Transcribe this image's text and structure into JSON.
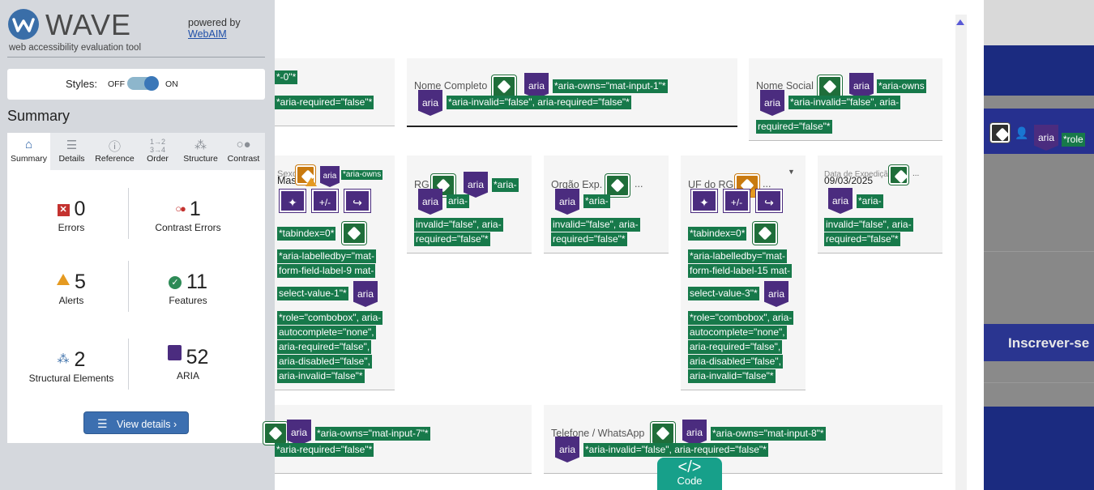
{
  "wave": {
    "title": "WAVE",
    "subtitle": "web accessibility evaluation tool",
    "powered_by": "powered by",
    "webaim_link": "WebAIM",
    "styles_label": "Styles:",
    "off_label": "OFF",
    "on_label": "ON",
    "summary_heading": "Summary",
    "tabs": [
      {
        "label": "Summary",
        "icon": "home-icon",
        "active": true
      },
      {
        "label": "Details",
        "icon": "list-icon"
      },
      {
        "label": "Reference",
        "icon": "info-icon"
      },
      {
        "label": "Order",
        "icon": "order-icon"
      },
      {
        "label": "Structure",
        "icon": "structure-icon"
      },
      {
        "label": "Contrast",
        "icon": "contrast-icon"
      }
    ],
    "stats": {
      "errors": {
        "count": "0",
        "label": "Errors"
      },
      "contrast_errors": {
        "count": "1",
        "label": "Contrast Errors"
      },
      "alerts": {
        "count": "5",
        "label": "Alerts"
      },
      "features": {
        "count": "11",
        "label": "Features"
      },
      "structural": {
        "count": "2",
        "label": "Structural Elements"
      },
      "aria": {
        "count": "52",
        "label": "ARIA"
      }
    },
    "view_details": "View details ›",
    "colors": {
      "accent": "#3c6fb0",
      "error": "#c4322f",
      "alert": "#e59a21",
      "feature": "#2e8b57",
      "aria": "#4b2c7f"
    }
  },
  "page": {
    "fields": {
      "partial_top": {
        "text1": "*-0\"*",
        "text2": "*aria-required=\"false\"*"
      },
      "nome_completo": {
        "label": "Nome Completo",
        "aria": "aria",
        "text1": "*aria-owns=\"mat-input-1\"*",
        "text2": "*aria-invalid=\"false\", aria-required=\"false\"*"
      },
      "nome_social": {
        "label": "Nome Social",
        "aria": "aria",
        "text1": "*aria-owns",
        "text2": "*aria-invalid=\"false\", aria-",
        "text3": "required=\"false\"*"
      },
      "sexo": {
        "label": "Sexo",
        "label_overlay": "Mas",
        "aria": "aria",
        "text_owns": "*aria-owns",
        "tabindex": "*tabindex=0*",
        "labelledby1": "*aria-labelledby=\"mat-",
        "labelledby2": "form-field-label-9 mat-",
        "labelledby3": "select-value-1\"*",
        "role1": "*role=\"combobox\", aria-",
        "role2": "autocomplete=\"none\",",
        "role3": "aria-required=\"false\",",
        "role4": "aria-disabled=\"false\",",
        "role5": "aria-invalid=\"false\"*",
        "btn_labels": [
          "✦",
          "+/-",
          "↪"
        ]
      },
      "rg": {
        "label": "RG",
        "aria": "aria",
        "text1": "*aria-",
        "text2": "aria-",
        "text3": "invalid=\"false\", aria-",
        "text4": "required=\"false\"*"
      },
      "orgao": {
        "label": "Orgão Exp.",
        "ellipsis": "...",
        "aria": "aria",
        "text1": "*aria-",
        "text2": "invalid=\"false\", aria-",
        "text3": "required=\"false\"*"
      },
      "uf_rg": {
        "label": "UF do RG",
        "ellipsis": "...",
        "aria": "aria",
        "tabindex": "*tabindex=0*",
        "labelledby1": "*aria-labelledby=\"mat-",
        "labelledby2": "form-field-label-15 mat-",
        "labelledby3": "select-value-3\"*",
        "role1": "*role=\"combobox\", aria-",
        "role2": "autocomplete=\"none\",",
        "role3": "aria-required=\"false\",",
        "role4": "aria-disabled=\"false\",",
        "role5": "aria-invalid=\"false\"*",
        "btn_labels": [
          "✦",
          "+/-",
          "↪"
        ]
      },
      "data_exp": {
        "label": "Data de Expedição",
        "ellipsis": "...",
        "value": "09/03/2025",
        "aria": "aria",
        "text1": "*aria-",
        "text2": "invalid=\"false\", aria-",
        "text3": "required=\"false\"*"
      },
      "partial_bottom": {
        "aria": "aria",
        "text1": "*aria-owns=\"mat-input-7\"*",
        "text2": "*aria-required=\"false\"*"
      },
      "telefone": {
        "label": "Telefone / WhatsApp",
        "aria": "aria",
        "text1": "*aria-owns=\"mat-input-8\"*",
        "text2": "*aria-invalid=\"false\", aria-required=\"false\"*"
      }
    },
    "code_tab": {
      "glyph": "</>",
      "label": "Code"
    }
  },
  "backdrop": {
    "aria": "aria",
    "role_text": "*role",
    "inscrever": "Inscrever-se"
  }
}
